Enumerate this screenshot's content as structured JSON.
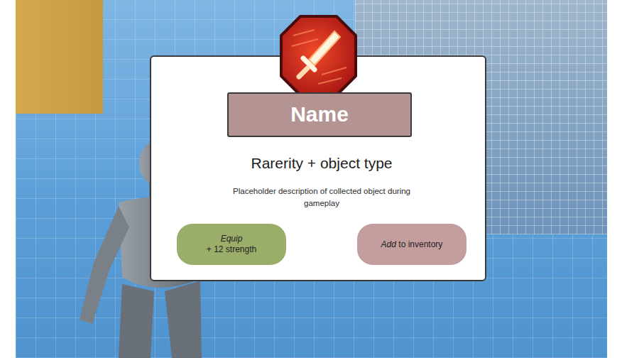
{
  "item": {
    "name": "Name",
    "type": "Rarerity + object type",
    "description": "Placeholder description of collected object during gameplay"
  },
  "buttons": {
    "equip": {
      "label": "Equip",
      "detail": "+ 12 strength"
    },
    "inventory": {
      "emphasis": "Add",
      "label": "to inventory"
    }
  }
}
